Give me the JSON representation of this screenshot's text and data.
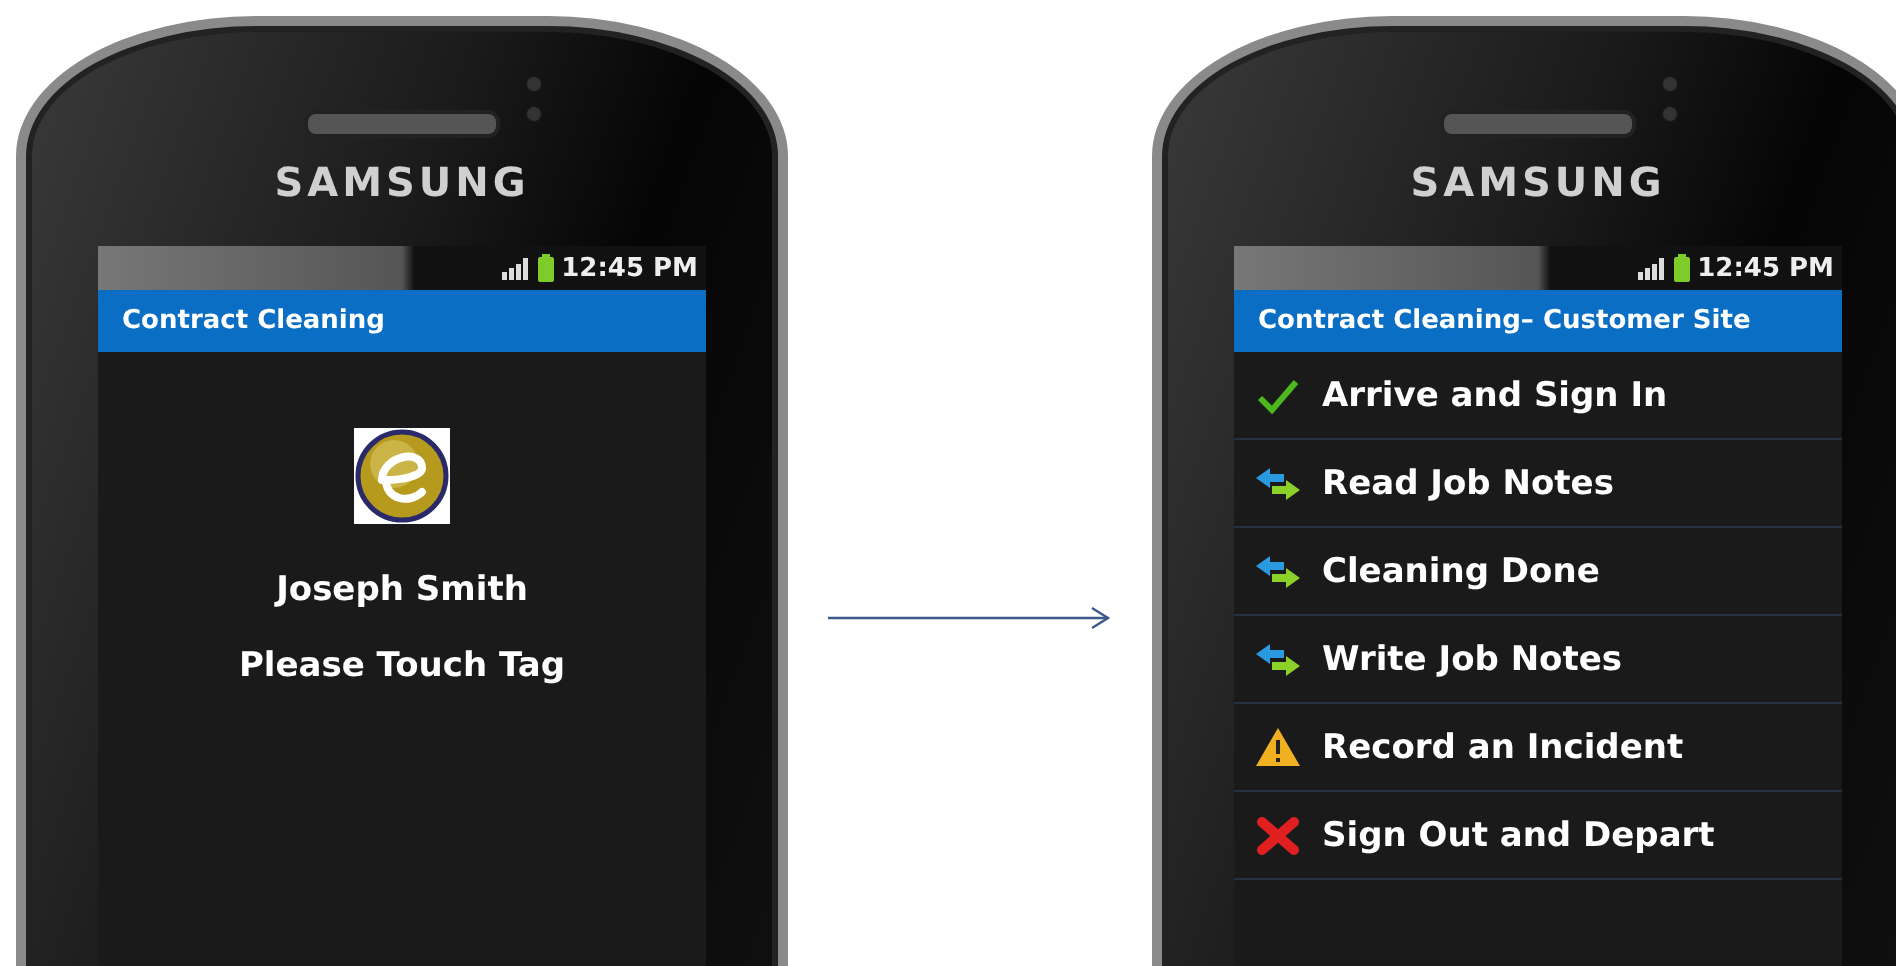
{
  "phones": [
    {
      "brand": "SAMSUNG",
      "status_time": "12:45 PM",
      "app_title": "Contract Cleaning",
      "kind": "tag",
      "user_name": "Joseph Smith",
      "prompt": "Please Touch Tag"
    },
    {
      "brand": "SAMSUNG",
      "status_time": "12:45 PM",
      "app_title": "Contract Cleaning– Customer Site",
      "kind": "menu",
      "menu_items": [
        {
          "label": "Arrive and Sign In",
          "kind": "check"
        },
        {
          "label": "Read Job Notes",
          "kind": "arrow"
        },
        {
          "label": "Cleaning Done",
          "kind": "arrow"
        },
        {
          "label": "Write Job Notes",
          "kind": "arrow"
        },
        {
          "label": "Record an Incident",
          "kind": "warning"
        },
        {
          "label": "Sign Out and Depart",
          "kind": "cross"
        }
      ]
    }
  ]
}
